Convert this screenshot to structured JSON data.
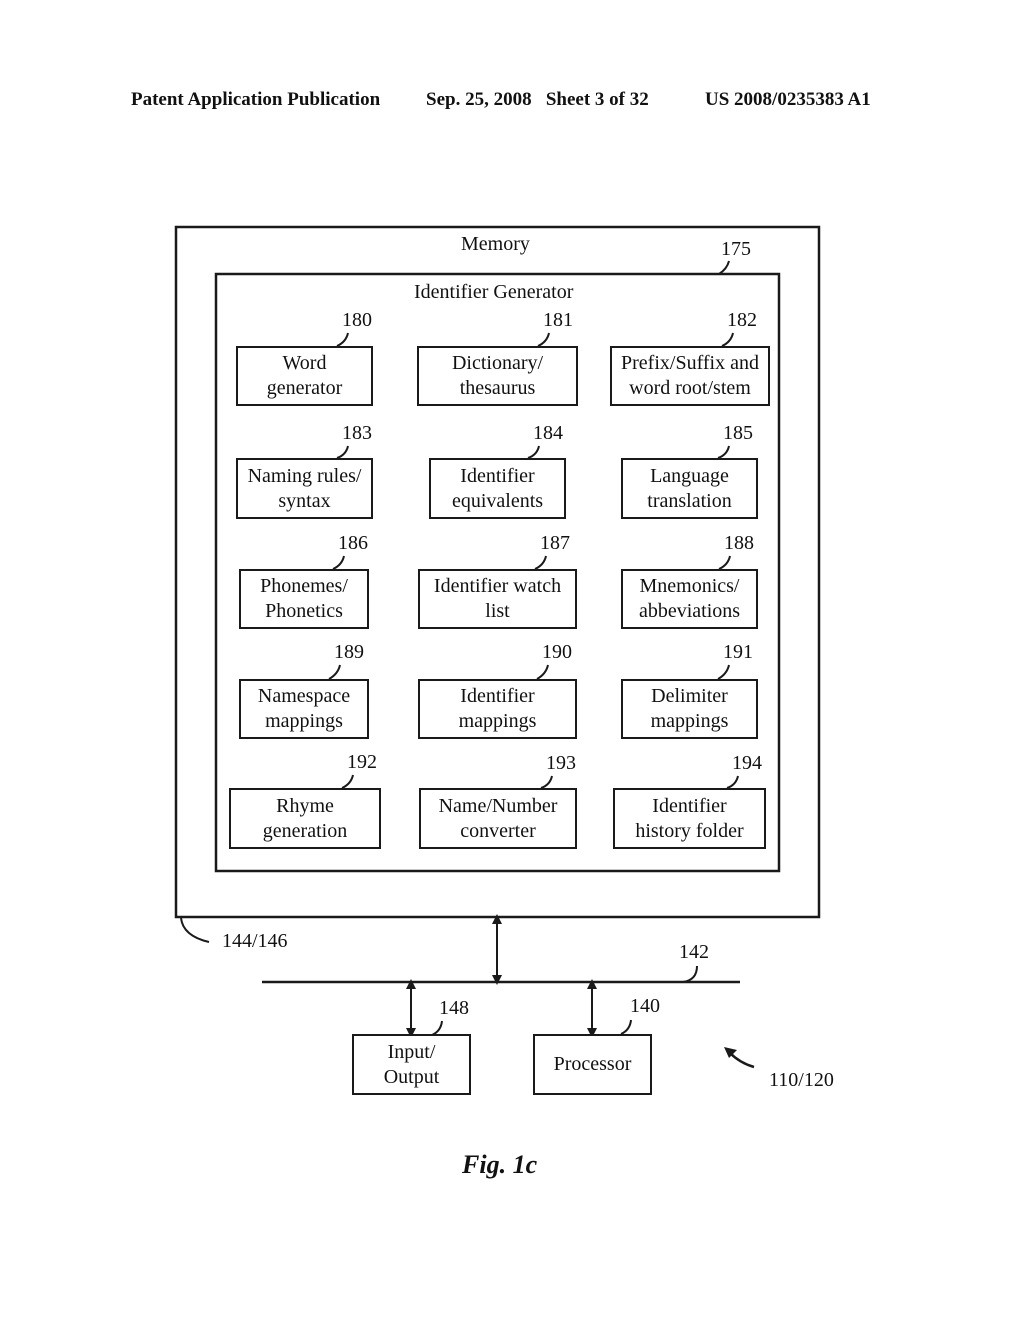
{
  "header": {
    "left": "Patent Application Publication",
    "center": "Sep. 25, 2008   Sheet 3 of 32",
    "right": "US 2008/0235383 A1"
  },
  "memory": {
    "title": "Memory",
    "ref": "144/146"
  },
  "identifier_generator": {
    "title": "Identifier Generator",
    "ref": "175",
    "modules": [
      {
        "ref": "180",
        "line1": "Word",
        "line2": "generator"
      },
      {
        "ref": "181",
        "line1": "Dictionary/",
        "line2": "thesaurus"
      },
      {
        "ref": "182",
        "line1": "Prefix/Suffix and",
        "line2": "word root/stem"
      },
      {
        "ref": "183",
        "line1": "Naming rules/",
        "line2": "syntax"
      },
      {
        "ref": "184",
        "line1": "Identifier",
        "line2": "equivalents"
      },
      {
        "ref": "185",
        "line1": "Language",
        "line2": "translation"
      },
      {
        "ref": "186",
        "line1": "Phonemes/",
        "line2": "Phonetics"
      },
      {
        "ref": "187",
        "line1": "Identifier watch",
        "line2": "list"
      },
      {
        "ref": "188",
        "line1": "Mnemonics/",
        "line2": "abbeviations"
      },
      {
        "ref": "189",
        "line1": "Namespace",
        "line2": "mappings"
      },
      {
        "ref": "190",
        "line1": "Identifier",
        "line2": "mappings"
      },
      {
        "ref": "191",
        "line1": "Delimiter",
        "line2": "mappings"
      },
      {
        "ref": "192",
        "line1": "Rhyme",
        "line2": "generation"
      },
      {
        "ref": "193",
        "line1": "Name/Number",
        "line2": "converter"
      },
      {
        "ref": "194",
        "line1": "Identifier",
        "line2": "history folder"
      }
    ]
  },
  "bus": {
    "ref": "142"
  },
  "io": {
    "line1": "Input/",
    "line2": "Output",
    "ref": "148"
  },
  "processor": {
    "label": "Processor",
    "ref": "140"
  },
  "system": {
    "ref": "110/120"
  },
  "figure_caption": "Fig. 1c"
}
